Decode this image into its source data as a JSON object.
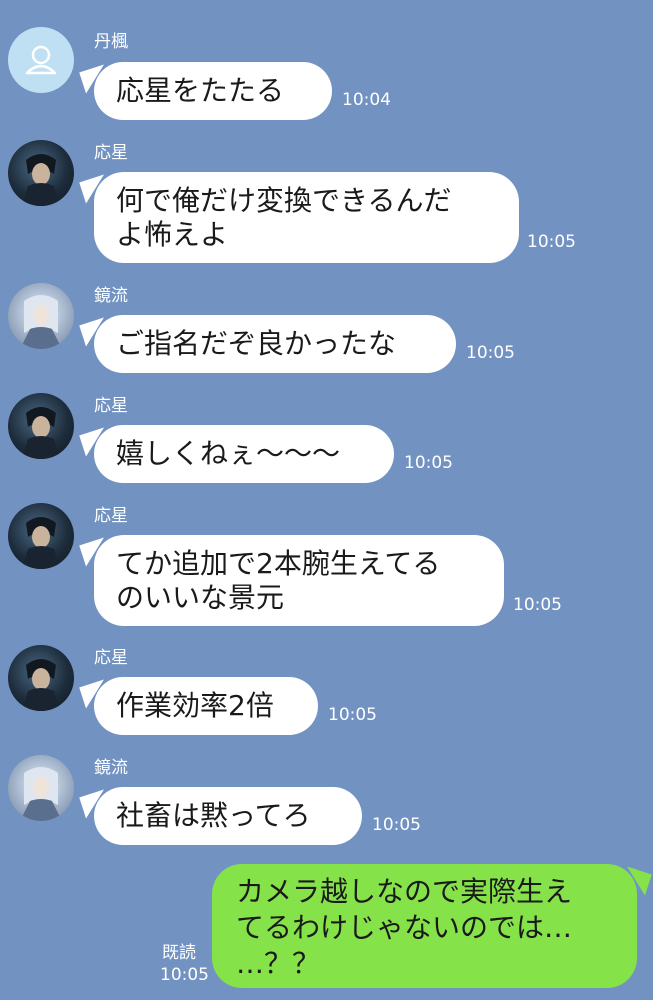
{
  "messages": [
    {
      "sender": "丹楓",
      "avatar": "default-person-icon",
      "text": "応星をたたる",
      "time": "10:04"
    },
    {
      "sender": "応星",
      "avatar": "dark-character-avatar",
      "text_lines": [
        "何で俺だけ変換できるんだ",
        "よ怖えよ"
      ],
      "time": "10:05"
    },
    {
      "sender": "鏡流",
      "avatar": "light-character-avatar",
      "text": "ご指名だぞ良かったな",
      "time": "10:05"
    },
    {
      "sender": "応星",
      "avatar": "dark-character-avatar",
      "text": "嬉しくねぇ〜〜〜",
      "time": "10:05"
    },
    {
      "sender": "応星",
      "avatar": "dark-character-avatar",
      "text_lines": [
        "てか追加で2本腕生えてる",
        "のいいな景元"
      ],
      "time": "10:05"
    },
    {
      "sender": "応星",
      "avatar": "dark-character-avatar",
      "text": "作業効率2倍",
      "time": "10:05"
    },
    {
      "sender": "鏡流",
      "avatar": "light-character-avatar",
      "text": "社畜は黙ってろ",
      "time": "10:05"
    }
  ],
  "outgoing": {
    "text_lines": [
      "カメラ越しなので実際生え",
      "てるわけじゃないのでは…",
      "…？？"
    ],
    "read_label": "既読",
    "time": "10:05"
  },
  "colors": {
    "background": "#7293c2",
    "incoming_bubble": "#ffffff",
    "outgoing_bubble": "#85e249"
  }
}
